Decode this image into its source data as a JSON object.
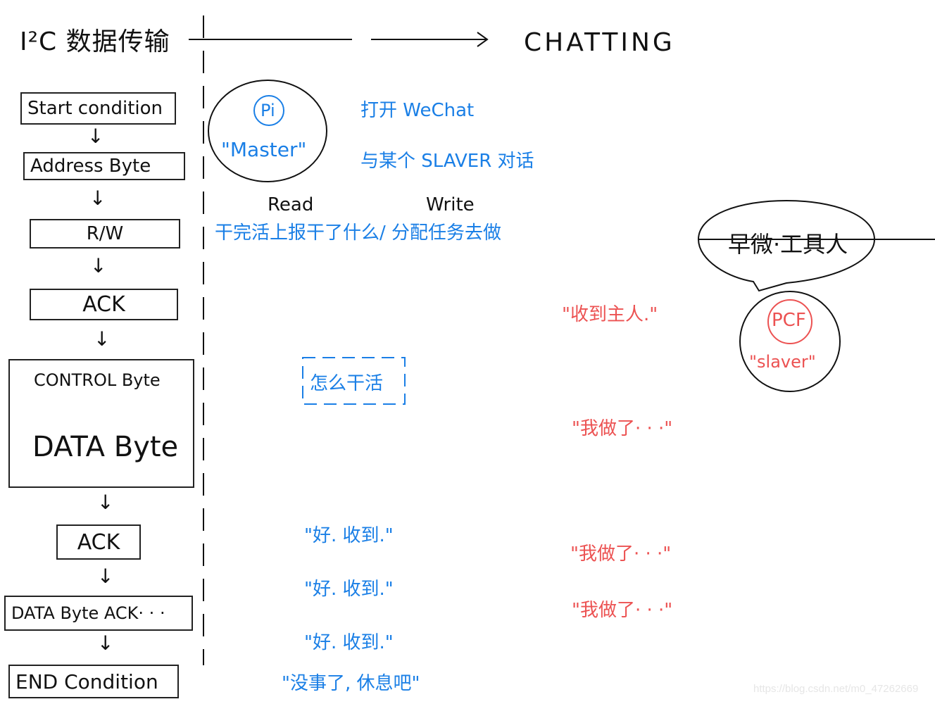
{
  "header": {
    "left_title": "I²C 数据传输",
    "right_title": "CHATTING"
  },
  "flow": {
    "steps": [
      {
        "label": "Start condition"
      },
      {
        "label": "Address Byte"
      },
      {
        "label": "R/W"
      },
      {
        "label": "ACK"
      },
      {
        "label": "CONTROL Byte",
        "sub": true
      },
      {
        "label": "DATA Byte"
      },
      {
        "label": "ACK"
      },
      {
        "label": "DATA Byte ACK· · ·"
      },
      {
        "label": "END Condition"
      }
    ],
    "arrow_glyph": "↓"
  },
  "master": {
    "badge": "Pi",
    "role": "\"Master\"",
    "lines": [
      "打开 WeChat",
      "与某个 SLAVER 对话"
    ]
  },
  "rw": {
    "read_label": "Read",
    "write_label": "Write",
    "description": "干完活上报干了什么/ 分配任务去做"
  },
  "slave": {
    "speech": "早微·工具人",
    "badge": "PCF",
    "role": "\"slaver\""
  },
  "dialogue": {
    "slave_greeting": "\"收到主人.\"",
    "master_howto": "怎么干活",
    "slave_did_1": "\"我做了· · ·\"",
    "master_ack_1": "\"好. 收到.\"",
    "slave_did_2": "\"我做了· · ·\"",
    "master_ack_2": "\"好. 收到.\"",
    "slave_did_3": "\"我做了· · ·\"",
    "master_ack_3": "\"好. 收到.\"",
    "master_end": "\"没事了, 休息吧\""
  },
  "watermark": "https://blog.csdn.net/m0_47262669",
  "colors": {
    "ink": "#111111",
    "master_blue": "#1a7fe6",
    "slave_red": "#ec5252"
  }
}
